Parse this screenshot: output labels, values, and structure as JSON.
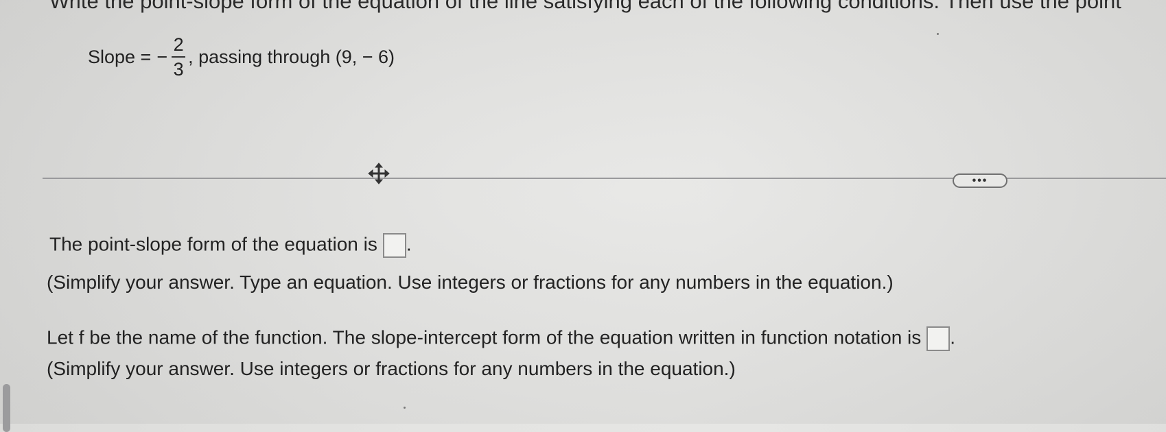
{
  "instructions_text": "Write the point-slope form of the equation of the line satisfying each of the following conditions. Then use the point",
  "problem": {
    "slope_label": "Slope =",
    "slope_sign": "−",
    "slope_numerator": "2",
    "slope_denominator": "3",
    "passing_text": ", passing through (9, − 6)"
  },
  "more_button_label": "•••",
  "question1": {
    "prompt": "The point-slope form of the equation is",
    "period": ".",
    "hint": "(Simplify your answer. Type an equation. Use integers or fractions for any numbers in the equation.)"
  },
  "question2": {
    "prompt": "Let f be the name of the function. The slope-intercept form of the equation written in function notation is",
    "period": ".",
    "hint": "(Simplify your answer. Use integers or fractions for any numbers in the equation.)"
  },
  "icons": {
    "move": "move-arrows-icon"
  }
}
